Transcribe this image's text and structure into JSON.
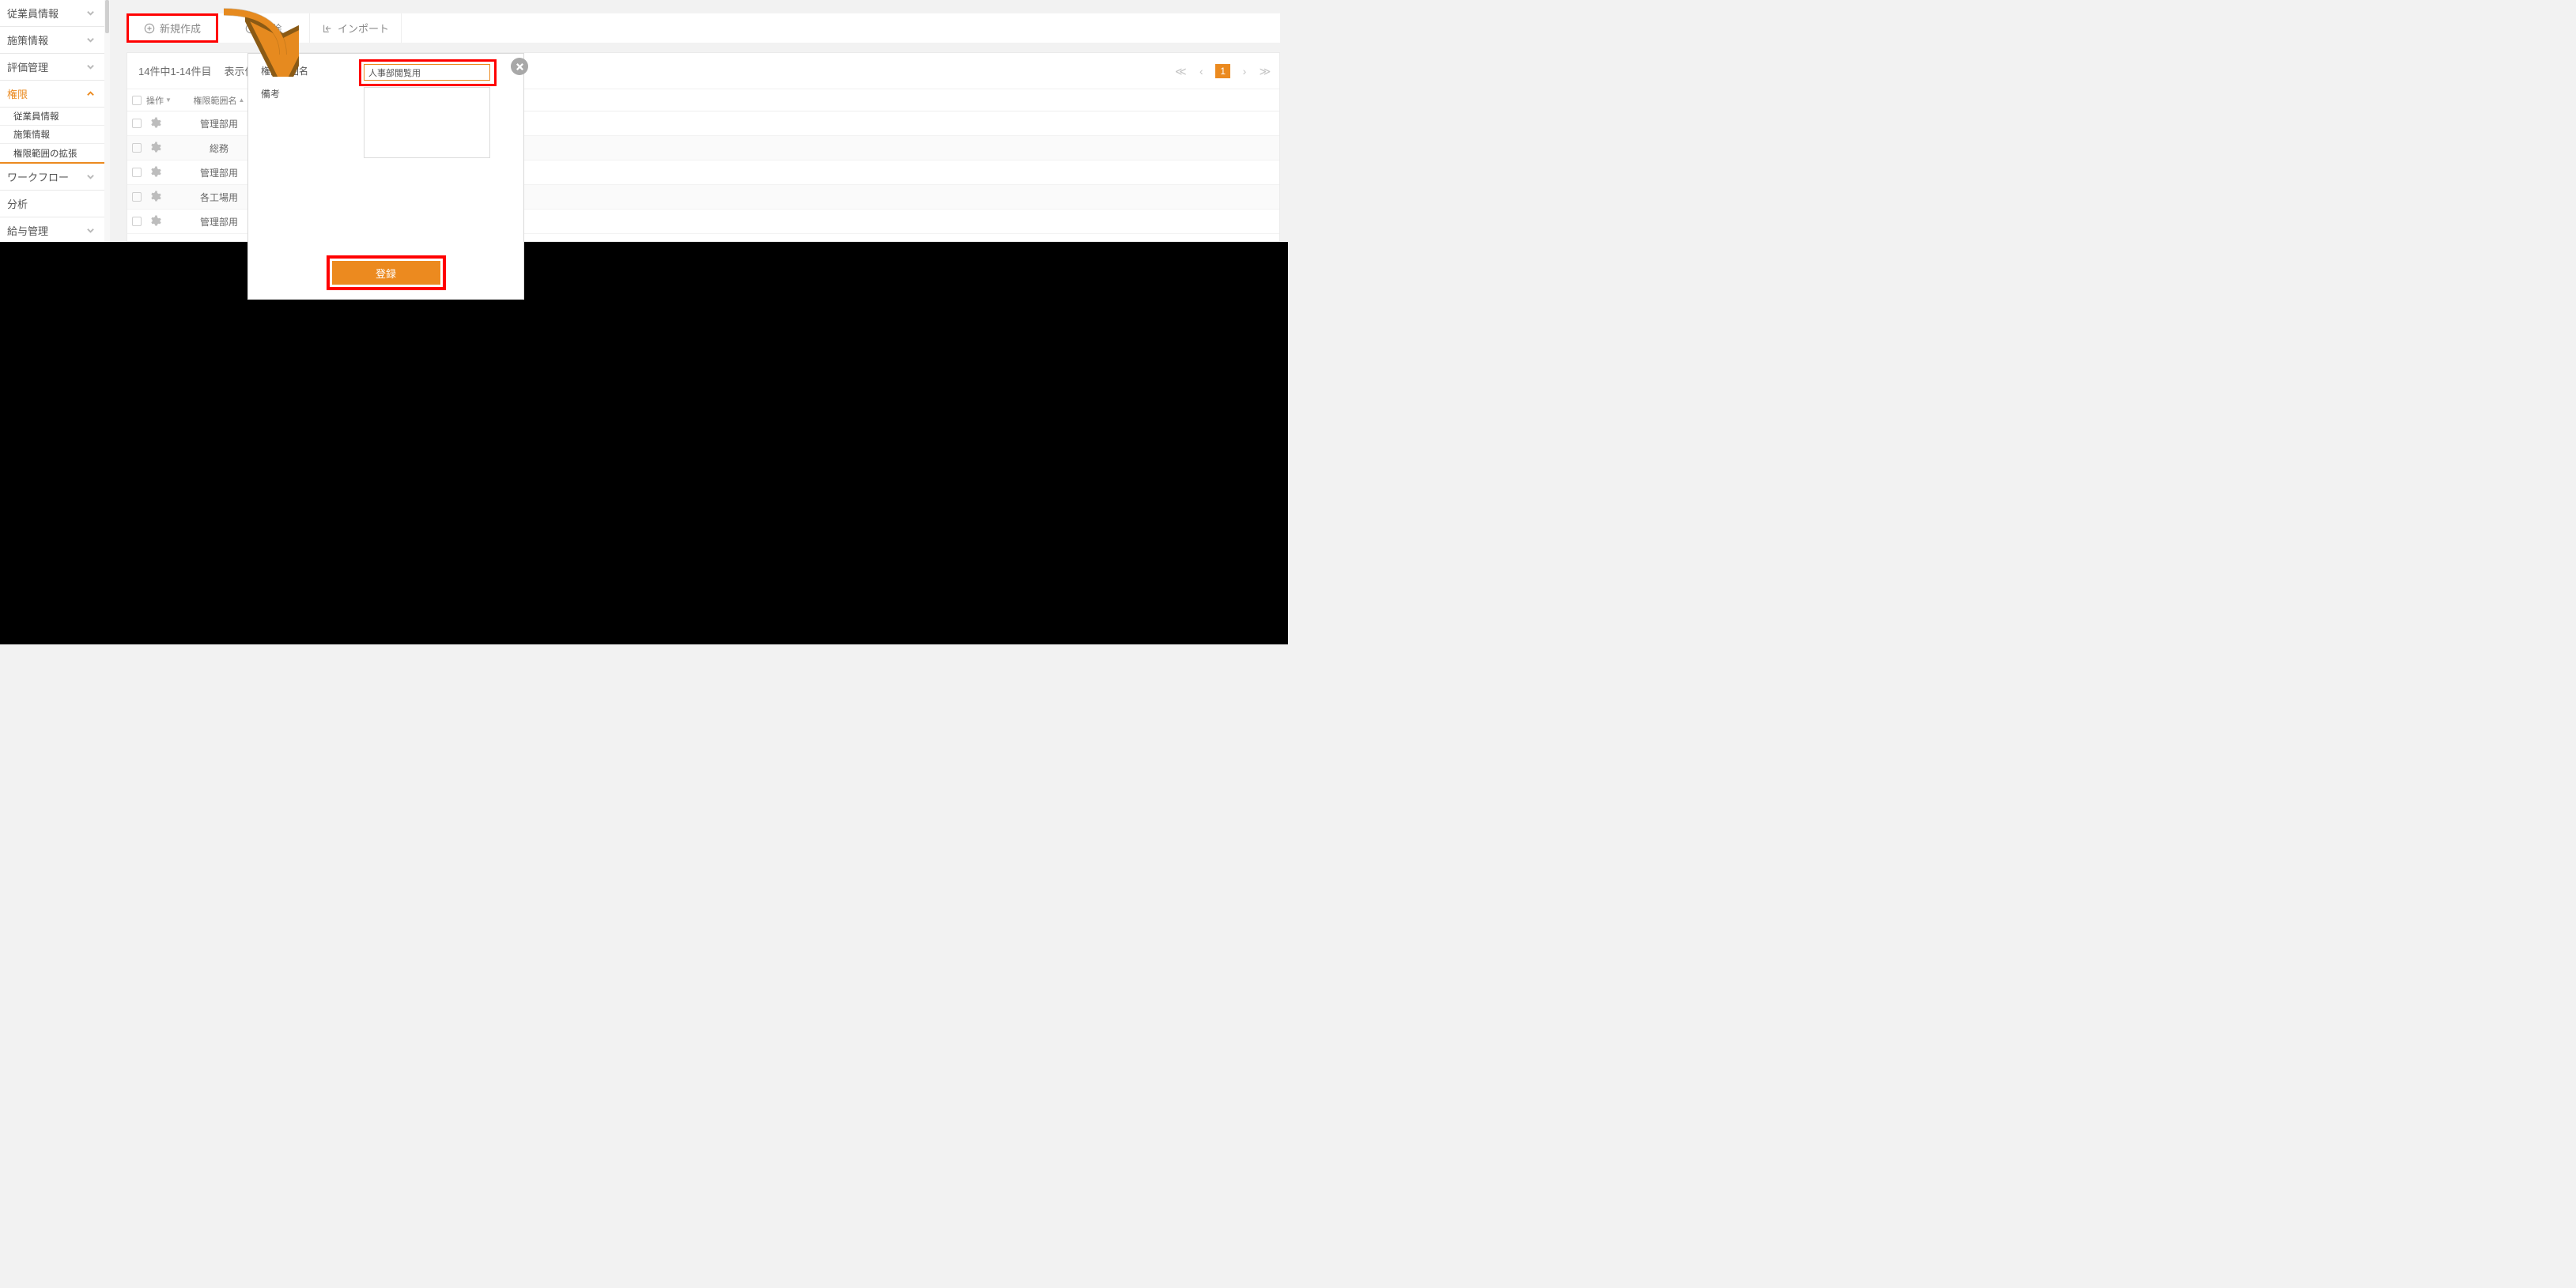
{
  "sidebar": {
    "items": [
      {
        "label": "従業員情報"
      },
      {
        "label": "施策情報"
      },
      {
        "label": "評価管理"
      },
      {
        "label": "権限"
      },
      {
        "label": "ワークフロー"
      },
      {
        "label": "分析"
      },
      {
        "label": "給与管理"
      }
    ],
    "subitems": [
      {
        "label": "従業員情報"
      },
      {
        "label": "施策情報"
      },
      {
        "label": "権限範囲の拡張"
      }
    ]
  },
  "toolbar": {
    "create": "新規作成",
    "delete": "削除",
    "import": "インポート"
  },
  "panel": {
    "count": "14件中1-14件目",
    "display": "表示件数",
    "current_page": "1"
  },
  "table": {
    "col_op": "操作",
    "col_name": "権限範囲名",
    "rows": [
      {
        "name": "管理部用"
      },
      {
        "name": "総務"
      },
      {
        "name": "管理部用"
      },
      {
        "name": "各工場用"
      },
      {
        "name": "管理部用"
      }
    ]
  },
  "modal": {
    "name_label": "権限範囲名",
    "note_label": "備考",
    "name_value": "人事部閲覧用",
    "note_value": "",
    "register": "登録"
  }
}
